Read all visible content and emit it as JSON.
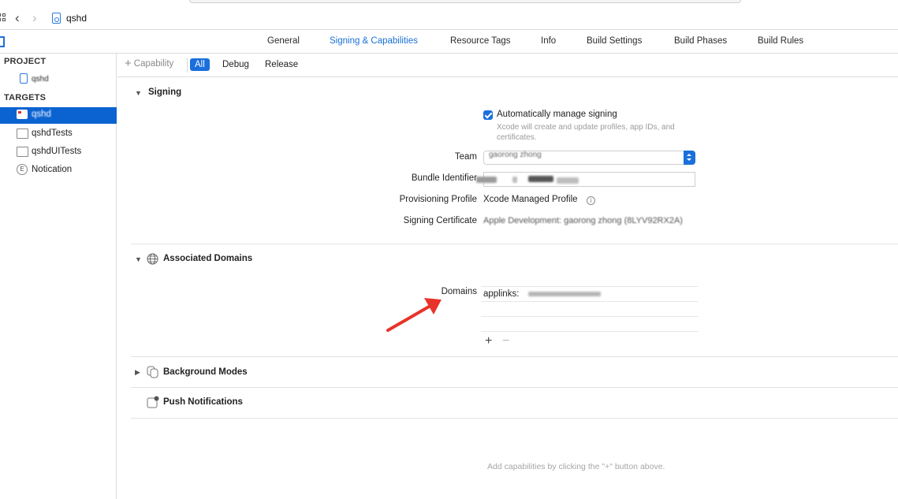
{
  "jumpbar": {
    "title": "qshd"
  },
  "tabs": [
    {
      "label": "General",
      "active": false
    },
    {
      "label": "Signing & Capabilities",
      "active": true
    },
    {
      "label": "Resource Tags",
      "active": false
    },
    {
      "label": "Info",
      "active": false
    },
    {
      "label": "Build Settings",
      "active": false
    },
    {
      "label": "Build Phases",
      "active": false
    },
    {
      "label": "Build Rules",
      "active": false
    }
  ],
  "navigator": {
    "project_header": "PROJECT",
    "project_name": "qshd",
    "targets_header": "TARGETS",
    "targets": [
      {
        "label": "qshd",
        "selected": true
      },
      {
        "label": "qshdTests",
        "selected": false
      },
      {
        "label": "qshdUITests",
        "selected": false
      },
      {
        "label": "Notication",
        "selected": false
      }
    ]
  },
  "filterbar": {
    "capability_label": "Capability",
    "filters": [
      {
        "label": "All",
        "active": true
      },
      {
        "label": "Debug",
        "active": false
      },
      {
        "label": "Release",
        "active": false
      }
    ]
  },
  "signing": {
    "title": "Signing",
    "auto_manage_label": "Automatically manage signing",
    "auto_manage_checked": true,
    "auto_manage_hint": "Xcode will create and update profiles, app IDs, and certificates.",
    "team_label": "Team",
    "team_value": "gaorong zhong",
    "bundle_label": "Bundle Identifier",
    "profile_label": "Provisioning Profile",
    "profile_value": "Xcode Managed Profile",
    "certificate_label": "Signing Certificate",
    "certificate_value": "Apple Development: gaorong zhong (8LYV92RX2A)"
  },
  "associated_domains": {
    "title": "Associated Domains",
    "domains_label": "Domains",
    "domains": [
      "applinks:",
      ""
    ],
    "add_symbol": "+",
    "remove_symbol": "−"
  },
  "background_modes": {
    "title": "Background Modes"
  },
  "push_notifications": {
    "title": "Push Notifications"
  },
  "footer_hint": "Add capabilities by clicking the \"+\" button above.",
  "colors": {
    "accent": "#1b6fdc",
    "selection": "#0b63d1",
    "annotation_arrow": "#e8332a"
  }
}
